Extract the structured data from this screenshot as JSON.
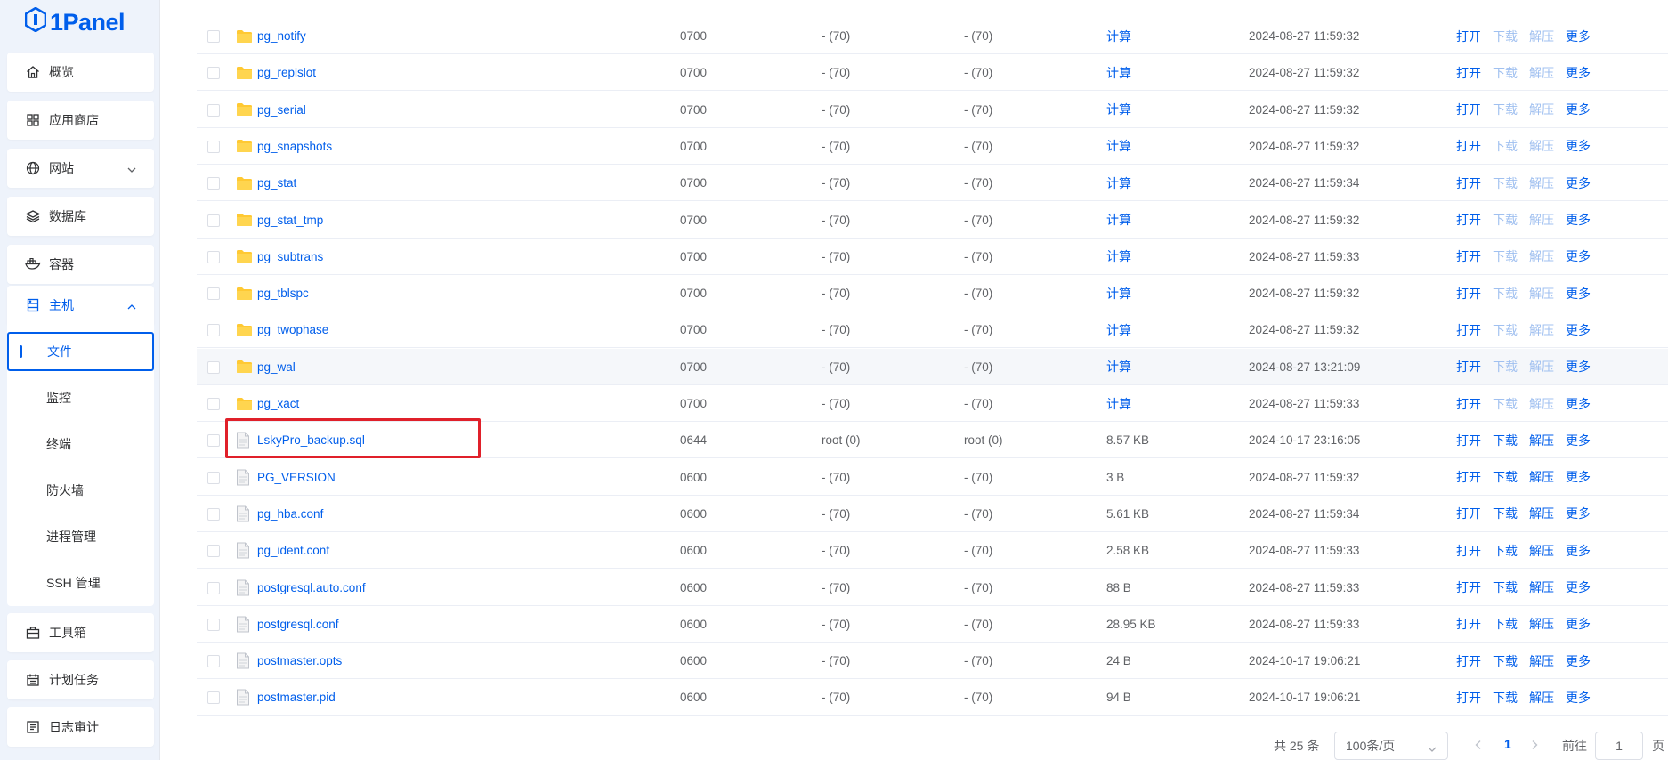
{
  "brand": {
    "name": "1Panel"
  },
  "sidebar": {
    "items": [
      {
        "label": "概览",
        "icon": "home-icon"
      },
      {
        "label": "应用商店",
        "icon": "grid-icon"
      },
      {
        "label": "网站",
        "icon": "globe-icon"
      },
      {
        "label": "数据库",
        "icon": "layers-icon"
      },
      {
        "label": "容器",
        "icon": "docker-icon"
      },
      {
        "label": "主机",
        "icon": "server-icon"
      },
      {
        "label": "工具箱",
        "icon": "toolbox-icon"
      },
      {
        "label": "计划任务",
        "icon": "calendar-icon"
      },
      {
        "label": "日志审计",
        "icon": "log-icon"
      }
    ],
    "host_sub": [
      "文件",
      "监控",
      "终端",
      "防火墙",
      "进程管理",
      "SSH 管理"
    ]
  },
  "ops": {
    "open": "打开",
    "download": "下载",
    "extract": "解压",
    "more": "更多"
  },
  "calc_label": "计算",
  "files": [
    {
      "name": "pg_notify",
      "type": "folder",
      "mode": "0700",
      "user": "- (70)",
      "group": "- (70)",
      "size": "",
      "time": "2024-08-27 11:59:32"
    },
    {
      "name": "pg_replslot",
      "type": "folder",
      "mode": "0700",
      "user": "- (70)",
      "group": "- (70)",
      "size": "",
      "time": "2024-08-27 11:59:32"
    },
    {
      "name": "pg_serial",
      "type": "folder",
      "mode": "0700",
      "user": "- (70)",
      "group": "- (70)",
      "size": "",
      "time": "2024-08-27 11:59:32"
    },
    {
      "name": "pg_snapshots",
      "type": "folder",
      "mode": "0700",
      "user": "- (70)",
      "group": "- (70)",
      "size": "",
      "time": "2024-08-27 11:59:32"
    },
    {
      "name": "pg_stat",
      "type": "folder",
      "mode": "0700",
      "user": "- (70)",
      "group": "- (70)",
      "size": "",
      "time": "2024-08-27 11:59:34"
    },
    {
      "name": "pg_stat_tmp",
      "type": "folder",
      "mode": "0700",
      "user": "- (70)",
      "group": "- (70)",
      "size": "",
      "time": "2024-08-27 11:59:32"
    },
    {
      "name": "pg_subtrans",
      "type": "folder",
      "mode": "0700",
      "user": "- (70)",
      "group": "- (70)",
      "size": "",
      "time": "2024-08-27 11:59:33"
    },
    {
      "name": "pg_tblspc",
      "type": "folder",
      "mode": "0700",
      "user": "- (70)",
      "group": "- (70)",
      "size": "",
      "time": "2024-08-27 11:59:32"
    },
    {
      "name": "pg_twophase",
      "type": "folder",
      "mode": "0700",
      "user": "- (70)",
      "group": "- (70)",
      "size": "",
      "time": "2024-08-27 11:59:32"
    },
    {
      "name": "pg_wal",
      "type": "folder",
      "mode": "0700",
      "user": "- (70)",
      "group": "- (70)",
      "size": "",
      "time": "2024-08-27 13:21:09"
    },
    {
      "name": "pg_xact",
      "type": "folder",
      "mode": "0700",
      "user": "- (70)",
      "group": "- (70)",
      "size": "",
      "time": "2024-08-27 11:59:33"
    },
    {
      "name": "LskyPro_backup.sql",
      "type": "file",
      "mode": "0644",
      "user": "root (0)",
      "group": "root (0)",
      "size": "8.57 KB",
      "time": "2024-10-17 23:16:05"
    },
    {
      "name": "PG_VERSION",
      "type": "file",
      "mode": "0600",
      "user": "- (70)",
      "group": "- (70)",
      "size": "3 B",
      "time": "2024-08-27 11:59:32"
    },
    {
      "name": "pg_hba.conf",
      "type": "file",
      "mode": "0600",
      "user": "- (70)",
      "group": "- (70)",
      "size": "5.61 KB",
      "time": "2024-08-27 11:59:34"
    },
    {
      "name": "pg_ident.conf",
      "type": "file",
      "mode": "0600",
      "user": "- (70)",
      "group": "- (70)",
      "size": "2.58 KB",
      "time": "2024-08-27 11:59:33"
    },
    {
      "name": "postgresql.auto.conf",
      "type": "file",
      "mode": "0600",
      "user": "- (70)",
      "group": "- (70)",
      "size": "88 B",
      "time": "2024-08-27 11:59:33"
    },
    {
      "name": "postgresql.conf",
      "type": "file",
      "mode": "0600",
      "user": "- (70)",
      "group": "- (70)",
      "size": "28.95 KB",
      "time": "2024-08-27 11:59:33"
    },
    {
      "name": "postmaster.opts",
      "type": "file",
      "mode": "0600",
      "user": "- (70)",
      "group": "- (70)",
      "size": "24 B",
      "time": "2024-10-17 19:06:21"
    },
    {
      "name": "postmaster.pid",
      "type": "file",
      "mode": "0600",
      "user": "- (70)",
      "group": "- (70)",
      "size": "94 B",
      "time": "2024-10-17 19:06:21"
    }
  ],
  "pagination": {
    "total": "共 25 条",
    "page_size": "100条/页",
    "current": "1",
    "goto_label": "前往",
    "goto_value": "1",
    "page_word": "页"
  },
  "colors": {
    "accent": "#005eeb",
    "highlight_box": "#e0202a",
    "sidebar_bg": "#eef3fb"
  }
}
